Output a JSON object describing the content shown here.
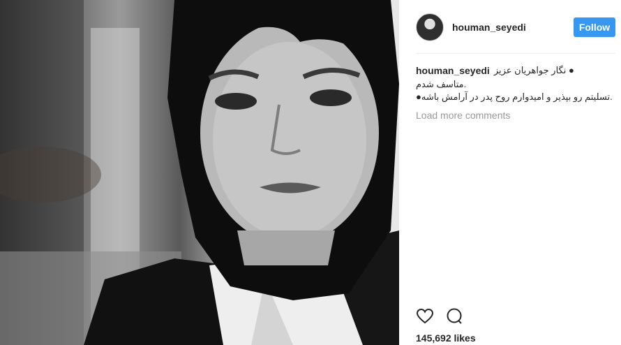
{
  "post": {
    "image_alt": "woman in headscarf portrait"
  },
  "header": {
    "username": "houman_seyedi",
    "follow_label": "Follow"
  },
  "caption": {
    "username": "houman_seyedi",
    "line1": "● نگار جواهریان عزیز",
    "line2": ".متاسف شدم",
    "line3": ".تسلیتم رو بپذیر و امیدوارم روح پدر در آرامش باشه●"
  },
  "comments": {
    "load_more": "Load more comments"
  },
  "actions": {
    "likes": "145,692 likes"
  },
  "colors": {
    "follow_button": "#3897f0",
    "muted_text": "#999999"
  },
  "icons": [
    "heart-icon",
    "comment-icon",
    "avatar"
  ]
}
